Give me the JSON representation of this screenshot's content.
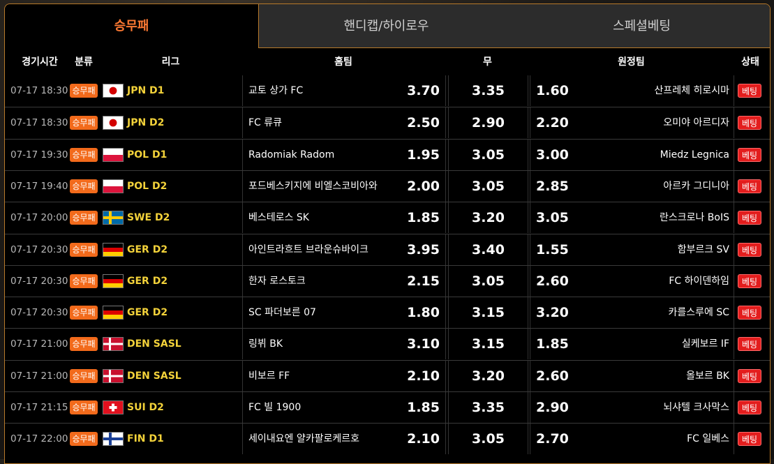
{
  "tabs": [
    {
      "label": "승무패",
      "active": true
    },
    {
      "label": "핸디캡/하이로우",
      "active": false
    },
    {
      "label": "스페셜베팅",
      "active": false
    }
  ],
  "columns": {
    "time": "경기시간",
    "category": "분류",
    "league": "리그",
    "home": "홈팀",
    "draw": "무",
    "away": "원정팀",
    "status": "상태"
  },
  "colors": {
    "accent": "#ff7a33",
    "badge": "#f26a1b",
    "league": "#f3d23a",
    "bet": "#e31d1d",
    "border": "#b87a2a"
  },
  "rows": [
    {
      "time": "07-17 18:30",
      "category": "승무패",
      "flag": "japan-flag",
      "league": "JPN D1",
      "home": "교토 상가 FC",
      "home_odd": "3.70",
      "draw_odd": "3.35",
      "away_odd": "1.60",
      "away": "산프레체 히로시마",
      "status": "베팅"
    },
    {
      "time": "07-17 18:30",
      "category": "승무패",
      "flag": "japan-flag",
      "league": "JPN D2",
      "home": "FC 류큐",
      "home_odd": "2.50",
      "draw_odd": "2.90",
      "away_odd": "2.20",
      "away": "오미야 아르디자",
      "status": "베팅"
    },
    {
      "time": "07-17 19:30",
      "category": "승무패",
      "flag": "poland-flag",
      "league": "POL D1",
      "home": "Radomiak Radom",
      "home_odd": "1.95",
      "draw_odd": "3.05",
      "away_odd": "3.00",
      "away": "Miedz Legnica",
      "status": "베팅"
    },
    {
      "time": "07-17 19:40",
      "category": "승무패",
      "flag": "poland-flag",
      "league": "POL D2",
      "home": "포드베스키지에 비엘스코비아와",
      "home_odd": "2.00",
      "draw_odd": "3.05",
      "away_odd": "2.85",
      "away": "아르카 그디니아",
      "status": "베팅"
    },
    {
      "time": "07-17 20:00",
      "category": "승무패",
      "flag": "sweden-flag",
      "league": "SWE D2",
      "home": "베스테로스 SK",
      "home_odd": "1.85",
      "draw_odd": "3.20",
      "away_odd": "3.05",
      "away": "란스크로나 BoIS",
      "status": "베팅"
    },
    {
      "time": "07-17 20:30",
      "category": "승무패",
      "flag": "germany-flag",
      "league": "GER D2",
      "home": "아인트라흐트 브라운슈바이크",
      "home_odd": "3.95",
      "draw_odd": "3.40",
      "away_odd": "1.55",
      "away": "함부르크 SV",
      "status": "베팅"
    },
    {
      "time": "07-17 20:30",
      "category": "승무패",
      "flag": "germany-flag",
      "league": "GER D2",
      "home": "한자 로스토크",
      "home_odd": "2.15",
      "draw_odd": "3.05",
      "away_odd": "2.60",
      "away": "FC 하이덴하임",
      "status": "베팅"
    },
    {
      "time": "07-17 20:30",
      "category": "승무패",
      "flag": "germany-flag",
      "league": "GER D2",
      "home": "SC 파더보른 07",
      "home_odd": "1.80",
      "draw_odd": "3.15",
      "away_odd": "3.20",
      "away": "카를스루에 SC",
      "status": "베팅"
    },
    {
      "time": "07-17 21:00",
      "category": "승무패",
      "flag": "denmark-flag",
      "league": "DEN SASL",
      "home": "링뷔 BK",
      "home_odd": "3.10",
      "draw_odd": "3.15",
      "away_odd": "1.85",
      "away": "실케보르 IF",
      "status": "베팅"
    },
    {
      "time": "07-17 21:00",
      "category": "승무패",
      "flag": "denmark-flag",
      "league": "DEN SASL",
      "home": "비보르 FF",
      "home_odd": "2.10",
      "draw_odd": "3.20",
      "away_odd": "2.60",
      "away": "올보르 BK",
      "status": "베팅"
    },
    {
      "time": "07-17 21:15",
      "category": "승무패",
      "flag": "switzerland-flag",
      "league": "SUI D2",
      "home": "FC 빌 1900",
      "home_odd": "1.85",
      "draw_odd": "3.35",
      "away_odd": "2.90",
      "away": "뇌샤텔 크사막스",
      "status": "베팅"
    },
    {
      "time": "07-17 22:00",
      "category": "승무패",
      "flag": "finland-flag",
      "league": "FIN D1",
      "home": "세이내요엔 얄카팔로케르호",
      "home_odd": "2.10",
      "draw_odd": "3.05",
      "away_odd": "2.70",
      "away": "FC 일베스",
      "status": "베팅"
    }
  ]
}
